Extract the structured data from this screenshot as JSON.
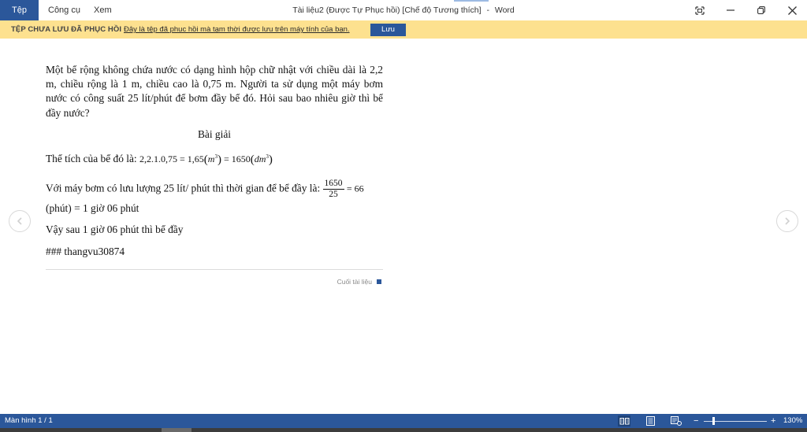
{
  "menu": {
    "file": "Tệp",
    "tools": "Công cụ",
    "view": "Xem"
  },
  "window": {
    "title": "Tài liệu2 (Được Tự Phục hồi) [Chế độ Tương thích]",
    "separator": "-",
    "app": "Word"
  },
  "banner": {
    "label": "TỆP CHƯA LƯU ĐÃ PHỤC HỒI",
    "message": "Đây là tệp đã phục hồi mà tạm thời được lưu trên máy tính của bạn.",
    "save_label": "Lưu"
  },
  "document": {
    "problem": "Một bể rộng không chứa nước có dạng hình hộp chữ nhật với chiều dài là 2,2 m, chiều rộng là 1 m, chiều cao là 0,75 m. Người ta sử dụng một máy bơm nước có công suất 25 lít/phút để bơm đầy bể đó. Hỏi sau bao nhiêu giờ thì bể đầy nước?",
    "solution_heading": "Bài giải",
    "volume_text": "Thể tích của bể đó là:",
    "volume_expr": "2,2.1.0,75 = 1,65",
    "volume_unit1": "m",
    "volume_mid": " = 1650",
    "volume_unit2": "dm",
    "cube": "3",
    "time_text": "Với máy bơm có lưu lượng 25 lít/ phút thì thời gian để bể đầy là:",
    "frac_num": "1650",
    "frac_den": "25",
    "time_result": "= 66",
    "minutes_line": "(phút) = 1 giờ 06 phút",
    "conclusion": "Vậy sau 1 giờ 06 phút thì bể đầy",
    "signature": "### thangvu30874",
    "end_label": "Cuối tài liệu"
  },
  "status": {
    "page": "Màn hình 1 / 1",
    "zoom_minus": "−",
    "zoom_plus": "+",
    "zoom": "130%"
  },
  "colors": {
    "accent": "#2b579a",
    "banner": "#fde18f"
  }
}
